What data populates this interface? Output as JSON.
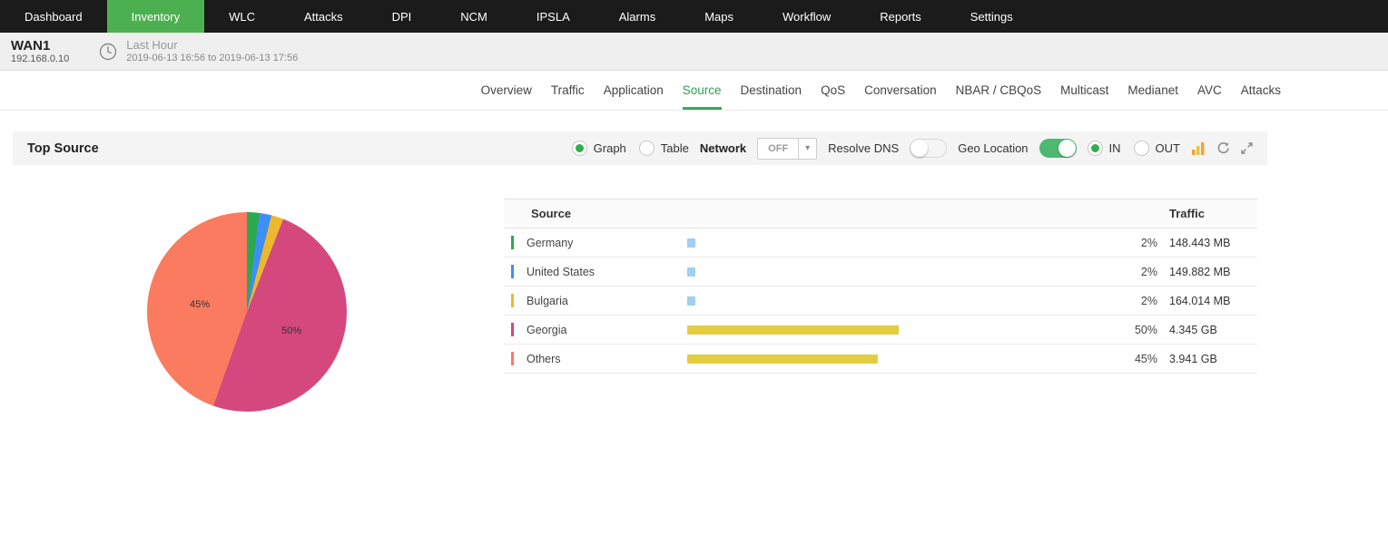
{
  "nav": {
    "items": [
      {
        "label": "Dashboard",
        "active": false
      },
      {
        "label": "Inventory",
        "active": true
      },
      {
        "label": "WLC",
        "active": false
      },
      {
        "label": "Attacks",
        "active": false
      },
      {
        "label": "DPI",
        "active": false
      },
      {
        "label": "NCM",
        "active": false
      },
      {
        "label": "IPSLA",
        "active": false
      },
      {
        "label": "Alarms",
        "active": false
      },
      {
        "label": "Maps",
        "active": false
      },
      {
        "label": "Workflow",
        "active": false
      },
      {
        "label": "Reports",
        "active": false
      },
      {
        "label": "Settings",
        "active": false
      }
    ]
  },
  "device_bar": {
    "name": "WAN1",
    "ip": "192.168.0.10",
    "time_range_label": "Last Hour",
    "time_range": "2019-06-13 16:56 to 2019-06-13 17:56"
  },
  "tabs": {
    "items": [
      "Overview",
      "Traffic",
      "Application",
      "Source",
      "Destination",
      "QoS",
      "Conversation",
      "NBAR / CBQoS",
      "Multicast",
      "Medianet",
      "AVC",
      "Attacks"
    ],
    "active": "Source"
  },
  "toolbar": {
    "title": "Top Source",
    "view_options": [
      {
        "label": "Graph",
        "selected": true
      },
      {
        "label": "Table",
        "selected": false
      }
    ],
    "network_label": "Network",
    "network_value": "OFF",
    "resolve_dns_label": "Resolve DNS",
    "resolve_dns_on": false,
    "geo_location_label": "Geo Location",
    "geo_location_on": true,
    "direction_options": [
      {
        "label": "IN",
        "selected": true
      },
      {
        "label": "OUT",
        "selected": false
      }
    ]
  },
  "chart_data": {
    "type": "pie",
    "title": "Top Source",
    "labels": [
      "Germany",
      "United States",
      "Bulgaria",
      "Georgia",
      "Others"
    ],
    "values_percent": [
      2,
      2,
      2,
      50,
      45
    ],
    "colors": [
      "#2aa94f",
      "#3f8ef3",
      "#edb72e",
      "#d4487e",
      "#fa7b5f"
    ],
    "visible_labels": [
      "45%",
      "50%"
    ],
    "legend_position": "none"
  },
  "table": {
    "headers": [
      "Source",
      "Traffic"
    ],
    "rows": [
      {
        "source": "Germany",
        "percent": "2%",
        "traffic": "148.443 MB",
        "accent": "#2aa94f",
        "bar_color": "#9fd0f1",
        "bar_pct": 2
      },
      {
        "source": "United States",
        "percent": "2%",
        "traffic": "149.882 MB",
        "accent": "#3f8ef3",
        "bar_color": "#9fd0f1",
        "bar_pct": 2
      },
      {
        "source": "Bulgaria",
        "percent": "2%",
        "traffic": "164.014 MB",
        "accent": "#edb72e",
        "bar_color": "#9fd0f1",
        "bar_pct": 2
      },
      {
        "source": "Georgia",
        "percent": "50%",
        "traffic": "4.345 GB",
        "accent": "#d4487e",
        "bar_color": "#e3cd3f",
        "bar_pct": 50
      },
      {
        "source": "Others",
        "percent": "45%",
        "traffic": "3.941 GB",
        "accent": "#fa7b5f",
        "bar_color": "#e3cd3f",
        "bar_pct": 45
      }
    ]
  }
}
